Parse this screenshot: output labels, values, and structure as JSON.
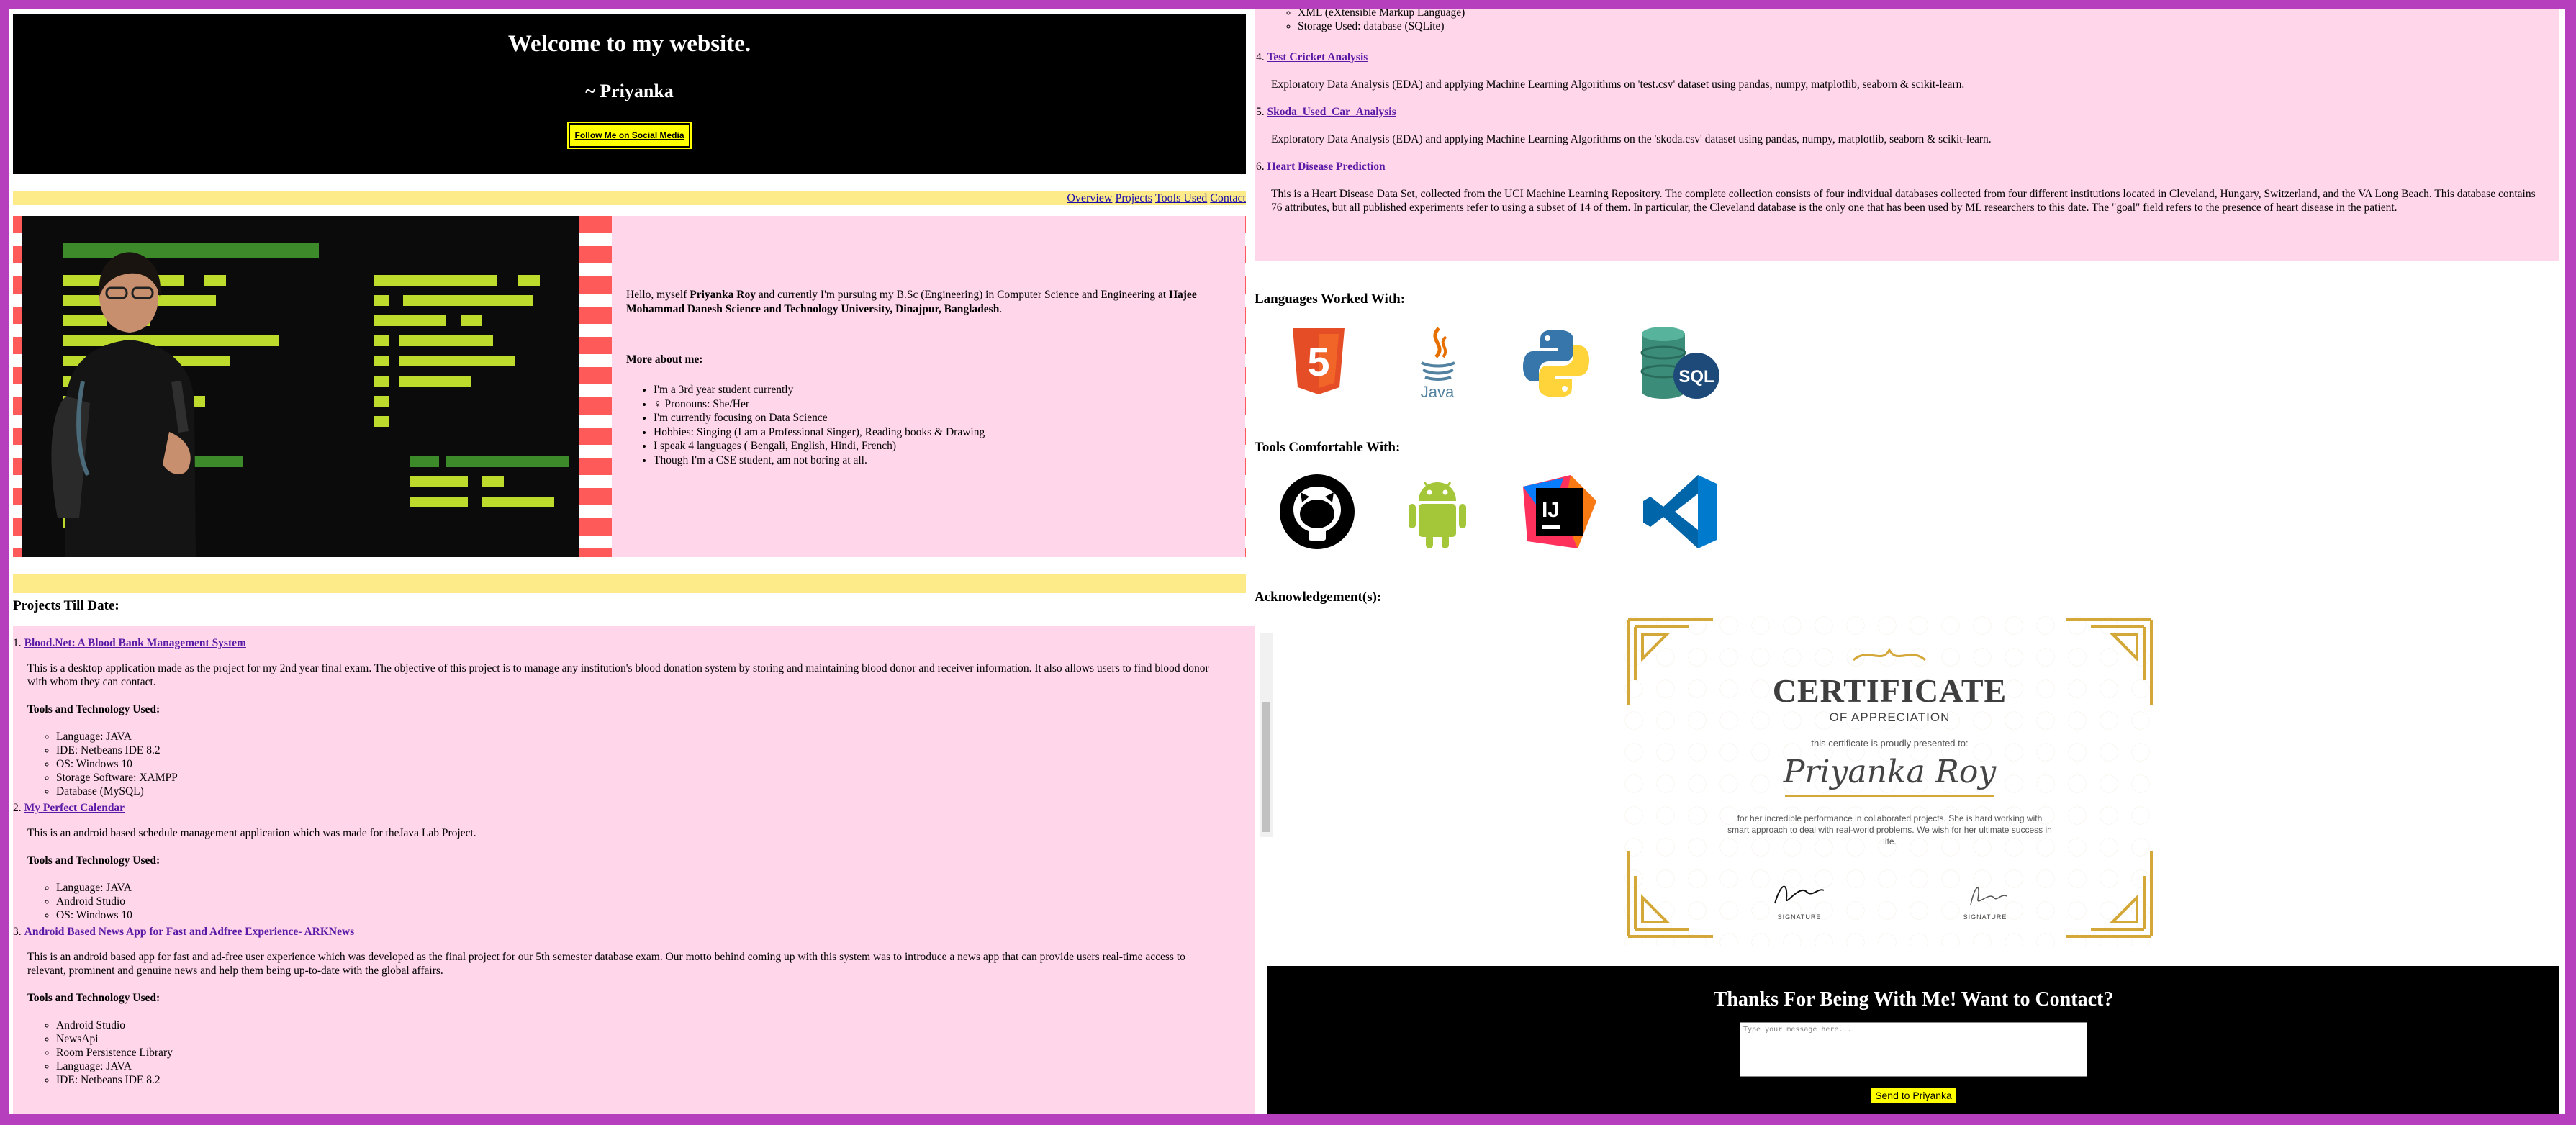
{
  "hero": {
    "title": "Welcome to my website.",
    "signature": "~ Priyanka",
    "follow_button": "Follow Me on Social Media"
  },
  "nav": {
    "links": [
      "Overview",
      "Projects",
      "Tools Used",
      "Contact"
    ]
  },
  "about": {
    "intro_prefix": "Hello, myself ",
    "name": "Priyanka Roy",
    "intro_mid": " and currently I'm pursuing my B.Sc (Engineering) in Computer Science and Engineering at ",
    "university": "Hajee Mohammad Danesh Science and Technology University, Dinajpur, Bangladesh",
    "intro_end": ".",
    "more_heading": "More about me:",
    "facts": [
      "I'm a 3rd year student currently",
      "♀ Pronouns: She/Her",
      "I'm currently focusing on Data Science",
      "Hobbies: Singing (I am a Professional Singer), Reading books & Drawing",
      "I speak 4 languages ( Bengali, English, Hindi, French)",
      "Though I'm a CSE student, am not boring at all."
    ]
  },
  "projects": {
    "heading": "Projects Till Date:",
    "tools_heading": "Tools and Technology Used:",
    "items": [
      {
        "num": "1.",
        "title": "Blood.Net: A Blood Bank Management System",
        "desc": "This is a desktop application made as the project for my 2nd year final exam. The objective of this project is to manage any institution's blood donation system by storing and maintaining blood donor and receiver information. It also allows users to find blood donor with whom they can contact.",
        "tools": [
          "Language: JAVA",
          "IDE: Netbeans IDE 8.2",
          "OS: Windows 10",
          "Storage Software: XAMPP",
          "Database (MySQL)"
        ]
      },
      {
        "num": "2.",
        "title": "My Perfect Calendar",
        "desc": "This is an android based schedule management application which was made for theJava Lab Project.",
        "tools": [
          "Language: JAVA",
          "Android Studio",
          "OS: Windows 10"
        ]
      },
      {
        "num": "3.",
        "title": "Android Based News App for Fast and Adfree Experience- ARKNews",
        "desc": "This is an android based app for fast and ad-free user experience which was developed as the final project for our 5th semester database exam. Our motto behind coming up with this system was to introduce a news app that can provide users real-time access to relevant, prominent and genuine news and help them being up-to-date with the global affairs.",
        "tools": [
          "Android Studio",
          "NewsApi",
          "Room Persistence Library",
          "Language: JAVA",
          "IDE: Netbeans IDE 8.2"
        ]
      }
    ],
    "right_top_tools": [
      "XML (eXtensible Markup Language)",
      "Storage Used: database (SQLite)"
    ],
    "right_items": [
      {
        "num": "4.",
        "title": "Test Cricket Analysis",
        "desc": "Exploratory Data Analysis (EDA) and applying Machine Learning Algorithms on 'test.csv' dataset using pandas, numpy, matplotlib, seaborn & scikit-learn."
      },
      {
        "num": "5.",
        "title": "Skoda_Used_Car_Analysis",
        "desc": "Exploratory Data Analysis (EDA) and applying Machine Learning Algorithms on the 'skoda.csv' dataset using pandas, numpy, matplotlib, seaborn & scikit-learn."
      },
      {
        "num": "6.",
        "title": "Heart Disease Prediction",
        "desc": "This is a Heart Disease Data Set, collected from the UCI Machine Learning Repository. The complete collection consists of four individual databases collected from four different institutions located in Cleveland, Hungary, Switzerland, and the VA Long Beach. This database contains 76 attributes, but all published experiments refer to using a subset of 14 of them. In particular, the Cleveland database is the only one that has been used by ML researchers to this date. The \"goal\" field refers to the presence of heart disease in the patient."
      }
    ]
  },
  "languages": {
    "heading": "Languages Worked With:",
    "icons": [
      "html5-icon",
      "java-icon",
      "python-icon",
      "sql-icon"
    ],
    "java_label": "Java",
    "html_label": "5",
    "sql_label": "SQL"
  },
  "tools": {
    "heading": "Tools Comfortable With:",
    "icons": [
      "github-icon",
      "android-icon",
      "intellij-icon",
      "vscode-icon"
    ],
    "intellij_label": "IJ"
  },
  "ack": {
    "heading": "Acknowledgement(s):",
    "cert_title": "CERTIFICATE",
    "cert_sub": "OF APPRECIATION",
    "cert_presented": "this certificate is proudly presented to:",
    "cert_name": "Priyanka Roy",
    "cert_text": "for her incredible performance in collaborated projects. She is hard working with smart approach to deal with real-world problems. We wish for her ultimate success in life.",
    "sig_label": "SIGNATURE"
  },
  "contact": {
    "heading": "Thanks For Being With Me! Want to Contact?",
    "placeholder": "Type your message here...",
    "send_label": "Send to Priyanka"
  },
  "colors": {
    "page_border": "#b53fbd",
    "card_pink": "#ffd6ea",
    "strip_yellow": "#fdeb8a",
    "button_yellow": "#ffff00",
    "link_purple": "#5a1aa6"
  }
}
